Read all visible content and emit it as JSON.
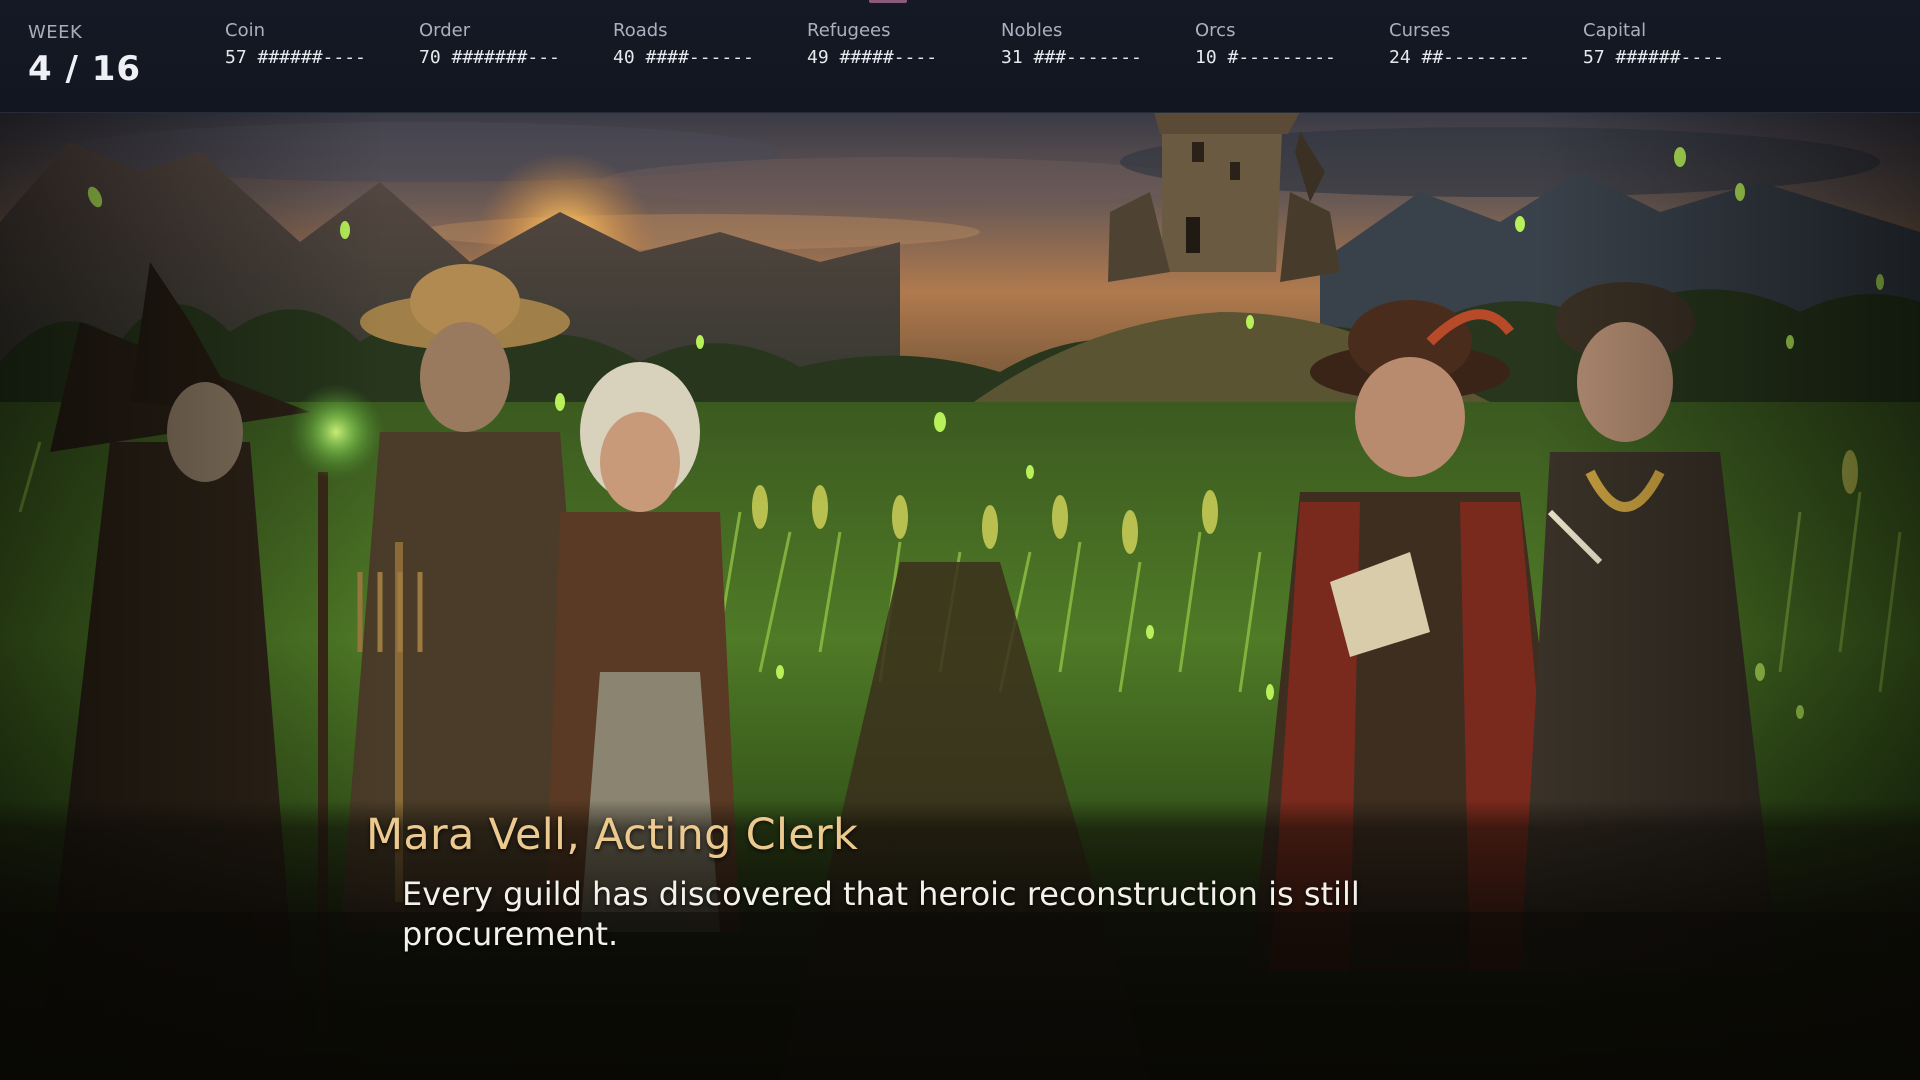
{
  "hud": {
    "week_label": "WEEK",
    "week_value": "4 / 16",
    "stats": [
      {
        "label": "Coin",
        "value": "57 ######----"
      },
      {
        "label": "Order",
        "value": "70 #######---"
      },
      {
        "label": "Roads",
        "value": "40 ####------"
      },
      {
        "label": "Refugees",
        "value": "49 #####----"
      },
      {
        "label": "Nobles",
        "value": "31 ###-------"
      },
      {
        "label": "Orcs",
        "value": "10 #---------"
      },
      {
        "label": "Curses",
        "value": "24 ##--------"
      },
      {
        "label": "Capital",
        "value": "57 ######----"
      }
    ]
  },
  "dialogue": {
    "speaker": "Mara Vell, Acting Clerk",
    "text": "Every guild has discovered that heroic reconstruction is still procurement."
  },
  "colors": {
    "hud_bg": "#141824",
    "speaker": "#ecc98e",
    "dialogue_text": "#f4f1ea",
    "accent_green": "#8fe05a"
  }
}
